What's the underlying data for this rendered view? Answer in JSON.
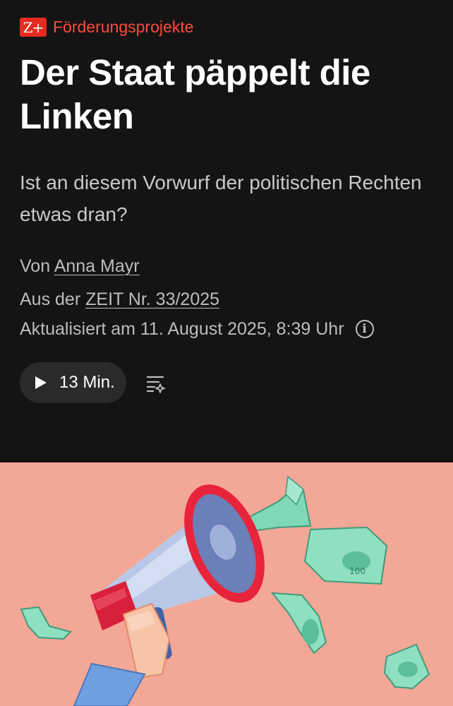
{
  "kicker": {
    "badge": "Z+",
    "label": "Förderungsprojekte"
  },
  "article": {
    "title": "Der Staat päppelt die Linken",
    "teaser": "Ist an diesem Vorwurf der politischen Rechten etwas dran?",
    "byline_prefix": "Von",
    "author": "Anna Mayr",
    "issue_prefix": "Aus der",
    "issue": "ZEIT Nr. 33/2025",
    "updated": "Aktualisiert am 11. August 2025, 8:39 Uhr"
  },
  "audio": {
    "duration_label": "13 Min."
  },
  "icons": {
    "info": "info-icon",
    "play": "play-icon",
    "summary": "ai-summary-icon"
  },
  "colors": {
    "background": "#141414",
    "accent": "#e52b21",
    "hero_bg": "#f3a796",
    "money_green": "#7fd8b6"
  }
}
